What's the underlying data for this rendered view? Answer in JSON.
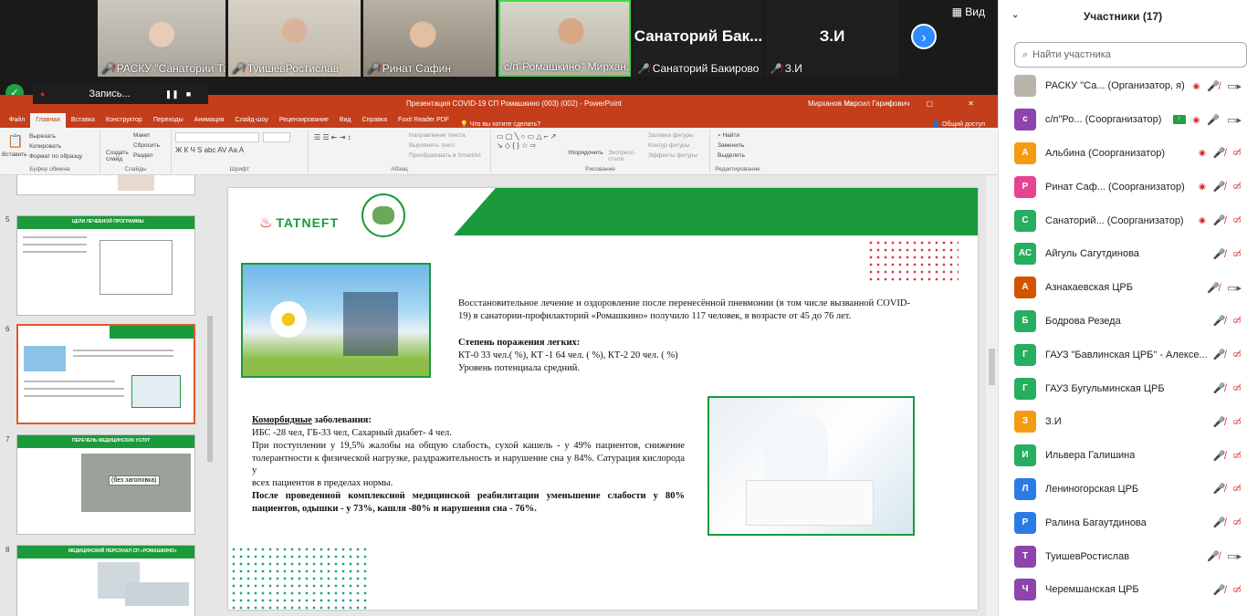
{
  "video_tiles": [
    {
      "name": "РАСКУ \"Санатории Та...",
      "bg": "#b9b5ac"
    },
    {
      "name": "ТуишевРостислав",
      "bg": "#c9c3b7"
    },
    {
      "name": "Ринат Сафин",
      "bg": "#a69f93"
    },
    {
      "name": "с/п\"Ромашкино\" Мирхан...",
      "bg": "#c7c5b7"
    },
    {
      "name": "Санаторий Бакирово",
      "big": "Санаторий Бак...",
      "bg": "#1f1f1f"
    },
    {
      "name": "З.И",
      "big": "З.И",
      "bg": "#1f1f1f"
    }
  ],
  "view_label": "Вид",
  "recording": {
    "label": "Запись..."
  },
  "ppt": {
    "title": "Презентация COVID-19 СП Ромашкино (003) (002)  -  PowerPoint",
    "user": "Мирханов Марсил Гарифович",
    "menu": [
      "Файл",
      "Главная",
      "Вставка",
      "Конструктор",
      "Переходы",
      "Анимация",
      "Слайд-шоу",
      "Рецензирование",
      "Вид",
      "Справка",
      "Foxit Reader PDF"
    ],
    "tell": "Что вы хотите сделать?",
    "share": "Общий доступ",
    "groups": [
      "Буфер обмена",
      "Слайды",
      "Шрифт",
      "Абзац",
      "Рисование",
      "Редактирование"
    ],
    "ribbon": {
      "paste": "Вставить",
      "cut": "Вырезать",
      "copy": "Копировать",
      "format": "Формат по образцу",
      "new_slide": "Создать слайд",
      "layout": "Макет",
      "reset": "Сбросить",
      "section": "Раздел",
      "text_dir": "Направление текста",
      "align_text": "Выровнять текст",
      "smartart": "Преобразовать в SmartArt",
      "arrange": "Упорядочить",
      "quick_styles": "Экспресс-стили",
      "fill": "Заливка фигуры",
      "outline": "Контур фигуры",
      "effects": "Эффекты фигуры",
      "find": "Найти",
      "replace": "Заменить",
      "select": "Выделить"
    },
    "thumb_numbers": [
      "5",
      "6",
      "7",
      "8"
    ],
    "thumb_titles": [
      "ЦЕЛИ ЛЕЧЕБНОЙ ПРОГРАММЫ",
      "",
      "ПЕРЕЧЕНЬ МЕДИЦИНСКИХ УСЛУГ",
      "МЕДИЦИНСКИЙ ПЕРСОНАЛ СП «РОМАШКИНО»"
    ],
    "thumb_tooltip": "(без заголовка)"
  },
  "slide": {
    "logo": "TATNEFT",
    "p1": "Восстановительное лечение  и оздоровление после перенесённой пневмонии (в том числе вызванной COVID-19) в санатории-профилакторий «Ромашкино» получило 117 человек, в возрасте от 45 до 76 лет.",
    "p2": "Степень поражения легких:",
    "p3": "КТ-0 33 чел.( %), КТ -1 64 чел. ( %), КТ-2 20 чел. ( %)",
    "p4": "Уровень потенциала средний.",
    "c1a": "Коморбидные",
    "c1b": " заболевания:",
    "c2": "ИБС -28 чел, ГБ-33 чел, Сахарный диабет- 4 чел.",
    "c3": "При поступлении у 19,5% жалобы на общую слабость, сухой кашель - у 49% пациентов, снижение толерантности к физической нагрузке, раздражительность и нарушение сна у 84%. Сатурация кислорода у",
    "c4": "всех пациентов в пределах нормы.",
    "c5": "После проведенной комплексной медицинской реабилитации уменьшение слабости у 80% пациентов, одышки - у 73%, кашля -80% и нарушения сна - 76%."
  },
  "panel": {
    "title": "Участники (17)",
    "search_placeholder": "Найти участника",
    "participants": [
      {
        "initial": "",
        "name": "РАСКУ \"Са...  (Организатор, я)",
        "color": "#b9b5ac",
        "video": "gray"
      },
      {
        "initial": "с",
        "name": "с/п\"Ро...  (Соорганизатор)",
        "color": "#8e44ad",
        "mic": "on",
        "share": true
      },
      {
        "initial": "А",
        "name": "Альбина (Соорганизатор)",
        "color": "#f39c12"
      },
      {
        "initial": "Р",
        "name": "Ринат Саф...  (Соорганизатор)",
        "color": "#e84393"
      },
      {
        "initial": "С",
        "name": "Санаторий...  (Соорганизатор)",
        "color": "#27ae60"
      },
      {
        "initial": "АС",
        "name": "Айгуль Сагутдинова",
        "color": "#27ae60"
      },
      {
        "initial": "А",
        "name": "Азнакаевская ЦРБ",
        "color": "#d35400"
      },
      {
        "initial": "Б",
        "name": "Бодрова Резеда",
        "color": "#27ae60"
      },
      {
        "initial": "Г",
        "name": "ГАУЗ \"Бавлинская ЦРБ\" - Алексе...",
        "color": "#27ae60"
      },
      {
        "initial": "Г",
        "name": "ГАУЗ Бугульминская ЦРБ",
        "color": "#27ae60"
      },
      {
        "initial": "З",
        "name": "З.И",
        "color": "#f39c12"
      },
      {
        "initial": "И",
        "name": "Ильвера Галишина",
        "color": "#27ae60"
      },
      {
        "initial": "Л",
        "name": "Лениногорская ЦРБ",
        "color": "#2c7be5"
      },
      {
        "initial": "Р",
        "name": "Ралина Багаутдинова",
        "color": "#2c7be5"
      },
      {
        "initial": "Т",
        "name": "ТуишевРостислав",
        "color": "#8e44ad"
      },
      {
        "initial": "Ч",
        "name": "Черемшанская ЦРБ",
        "color": "#8e44ad"
      }
    ]
  }
}
